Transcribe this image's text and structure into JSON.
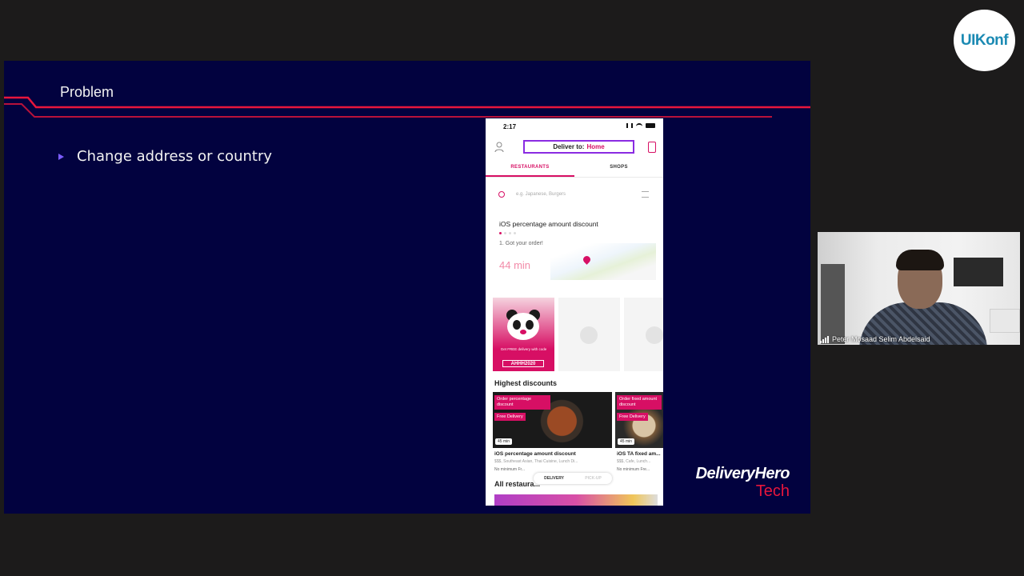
{
  "slide": {
    "title": "Problem",
    "bullet": "Change address or country",
    "brand_main": "DeliveryHero",
    "brand_sub": "Tech"
  },
  "phone": {
    "status_time": "2:17",
    "deliver_prefix": "Deliver to:",
    "deliver_location": "Home",
    "tabs": [
      {
        "label": "RESTAURANTS",
        "active": true
      },
      {
        "label": "SHOPS",
        "active": false
      }
    ],
    "search_placeholder": "e.g. Japanese, Burgers",
    "order": {
      "title": "iOS percentage amount discount",
      "status": "1. Got your order!",
      "eta": "44 min"
    },
    "promo": {
      "text": "Get FREE delivery with code",
      "code": "AHHH2020"
    },
    "highest_discounts_title": "Highest discounts",
    "cards": [
      {
        "tag": "Order percentage discount",
        "free": "Free Delivery",
        "time": "45 min",
        "name": "iOS percentage amount discount",
        "sub": "$$$, Southeast Asian, Thai Cuisine, Lunch Di...",
        "min": "No minimum   Fr..."
      },
      {
        "tag": "Order fixed amount discount",
        "free": "Free Delivery",
        "time": "45 min",
        "name": "iOS TA fixed am...",
        "sub": "$$$, Cafe, Lunch...",
        "min": "No minimum   Fre..."
      }
    ],
    "toggle": {
      "left": "DELIVERY",
      "right": "PICK-UP"
    },
    "all_restaurants_title": "All restaura..."
  },
  "uikonf": {
    "label": "UIKonf"
  },
  "webcam": {
    "speaker": "Peter Mosaad Selim Abdelsaid"
  },
  "colors": {
    "slide_bg": "#02023f",
    "accent_red": "#e8163c",
    "brand_pink": "#d70f64",
    "highlight_purple": "#8a2be2"
  }
}
